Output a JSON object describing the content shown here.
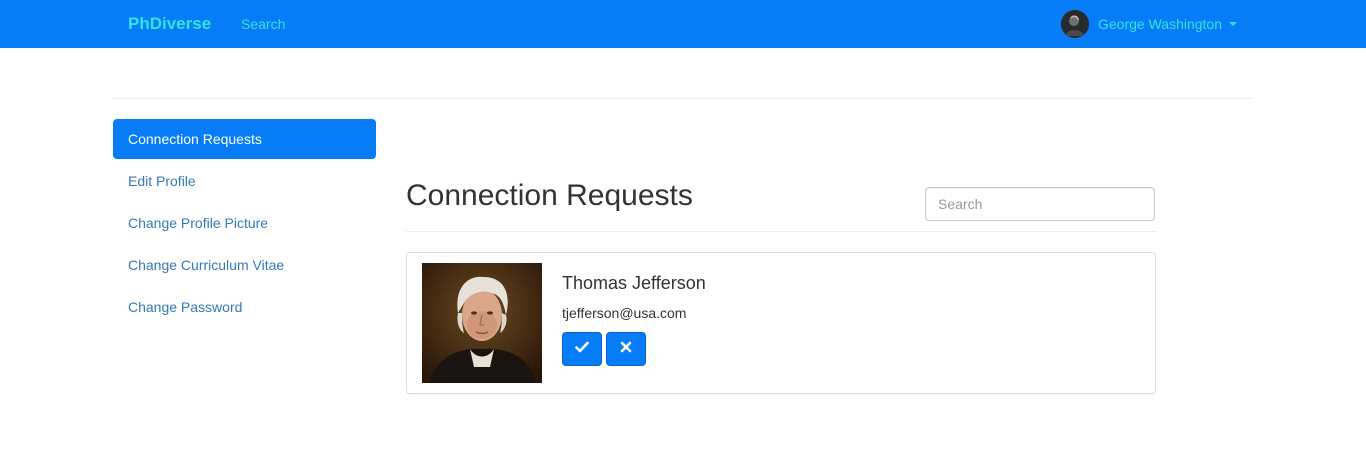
{
  "navbar": {
    "brand": "PhDiverse",
    "search_link": "Search",
    "user": {
      "name": "George Washington"
    }
  },
  "sidebar": {
    "items": [
      {
        "label": "Connection Requests",
        "active": true
      },
      {
        "label": "Edit Profile",
        "active": false
      },
      {
        "label": "Change Profile Picture",
        "active": false
      },
      {
        "label": "Change Curriculum Vitae",
        "active": false
      },
      {
        "label": "Change Password",
        "active": false
      }
    ]
  },
  "main": {
    "title": "Connection Requests",
    "search": {
      "placeholder": "Search",
      "value": ""
    },
    "requests": [
      {
        "name": "Thomas Jefferson",
        "email": "tjefferson@usa.com",
        "accept_icon": "check-icon",
        "reject_icon": "times-icon"
      }
    ]
  },
  "colors": {
    "primary": "#067df7",
    "brand_text": "#34e3e9",
    "link": "#337ab7"
  }
}
